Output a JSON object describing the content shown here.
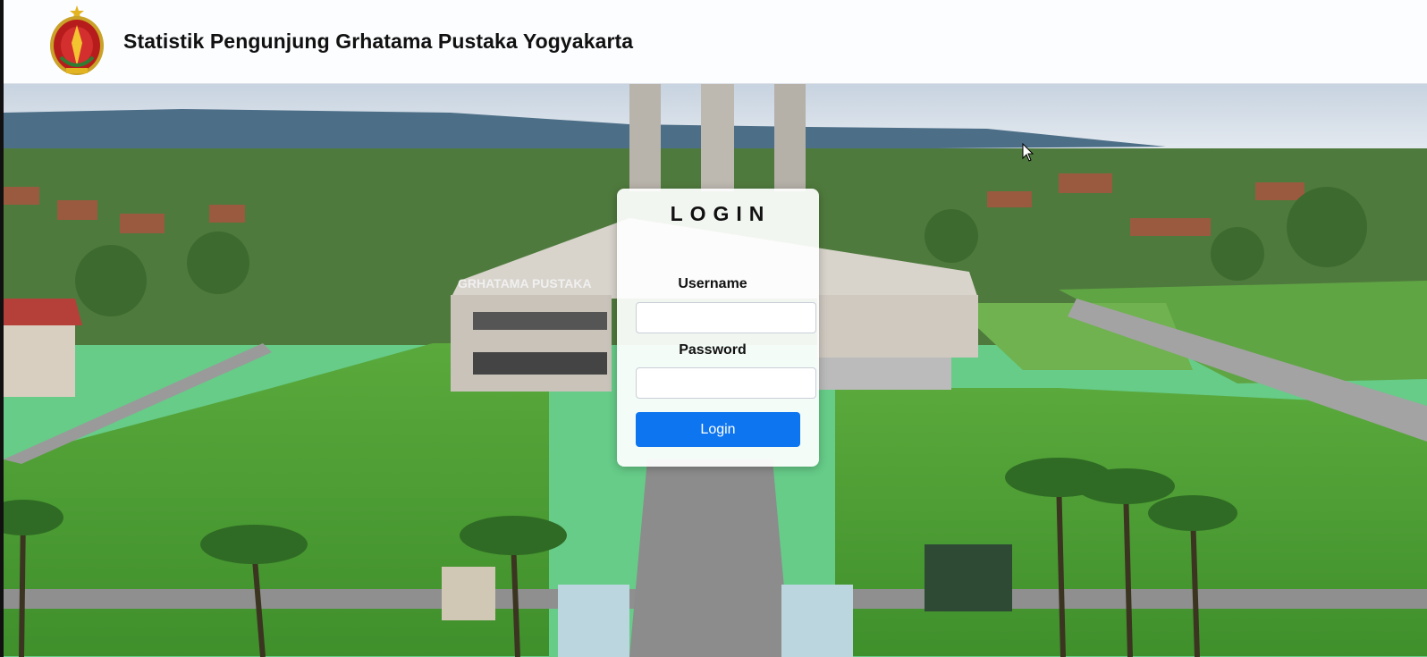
{
  "header": {
    "title": "Statistik Pengunjung Grhatama Pustaka Yogyakarta",
    "logo_icon": "yogyakarta-emblem-icon"
  },
  "login": {
    "title": "LOGIN",
    "username_label": "Username",
    "username_value": "",
    "password_label": "Password",
    "password_value": "",
    "button_label": "Login"
  },
  "building_sign": "GRHATAMA PUSTAKA",
  "colors": {
    "accent": "#0d75f0",
    "header_bg": "#fcfdff",
    "grass": "#4fa83a"
  }
}
